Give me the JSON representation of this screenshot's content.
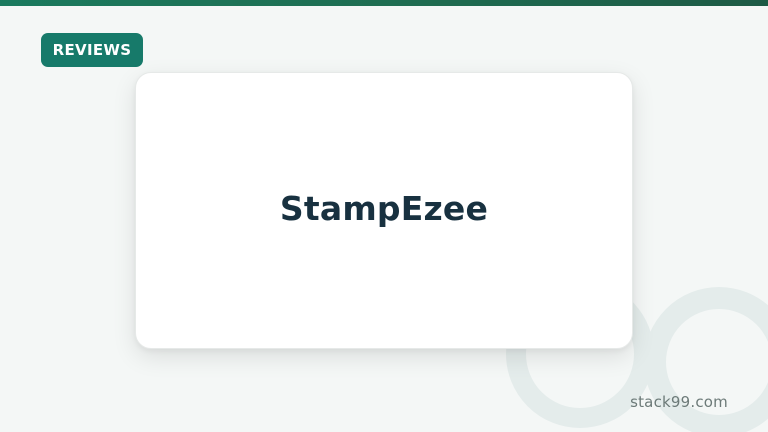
{
  "badge": {
    "label": "REVIEWS"
  },
  "card": {
    "title": "StampEzee"
  },
  "footer": {
    "site": "stack99.com"
  },
  "colors": {
    "accent": "#177a6a",
    "title": "#183140",
    "background": "#f4f7f6"
  }
}
